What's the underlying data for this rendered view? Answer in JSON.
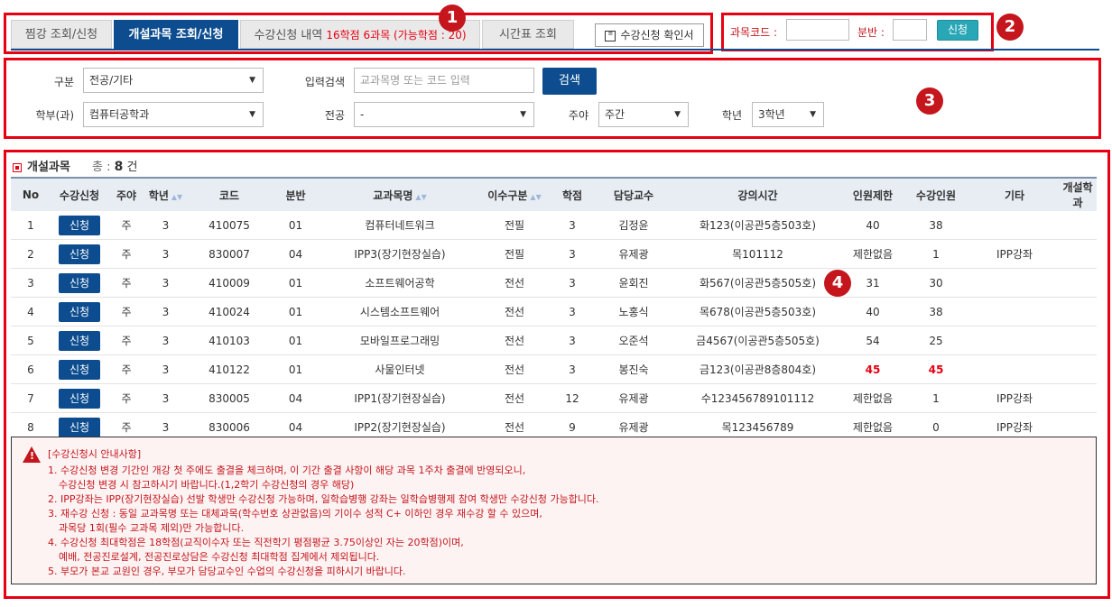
{
  "tabs": [
    {
      "label": "찜강 조회/신청"
    },
    {
      "label": "개설과목 조회/신청"
    },
    {
      "label": "수강신청 내역",
      "highlight": "16학점 6과목 (가능학점 : 20)"
    },
    {
      "label": "시간표 조회"
    }
  ],
  "confirm_button": "수강신청 확인서",
  "apply_form": {
    "course_code_label": "과목코드 :",
    "section_label": "분반 :",
    "submit": "신청",
    "course_code_value": "",
    "section_value": ""
  },
  "search": {
    "category_label": "구분",
    "category_value": "전공/기타",
    "keyword_label": "입력검색",
    "keyword_placeholder": "교과목명 또는 코드 입력",
    "search_button": "검색",
    "dept_label": "학부(과)",
    "dept_value": "컴퓨터공학과",
    "major_label": "전공",
    "major_value": "-",
    "daynight_label": "주야",
    "daynight_value": "주간",
    "year_label": "학년",
    "year_value": "3학년"
  },
  "list": {
    "title": "개설과목",
    "total_label": "총 :",
    "total_count": "8",
    "unit": "건"
  },
  "columns": [
    "No",
    "수강신청",
    "주야",
    "학년",
    "코드",
    "분반",
    "교과목명",
    "이수구분",
    "학점",
    "담당교수",
    "강의시간",
    "인원제한",
    "수강인원",
    "기타",
    "개설학과"
  ],
  "rows": [
    {
      "no": "1",
      "apply": "신청",
      "dn": "주",
      "year": "3",
      "code": "410075",
      "sec": "01",
      "name": "컴퓨터네트워크",
      "type": "전필",
      "credit": "3",
      "prof": "김정윤",
      "time": "화123(이공관5층503호)",
      "limit": "40",
      "enrolled": "38",
      "etc": "",
      "dept": ""
    },
    {
      "no": "2",
      "apply": "신청",
      "dn": "주",
      "year": "3",
      "code": "830007",
      "sec": "04",
      "name": "IPP3(장기현장실습)",
      "type": "전필",
      "credit": "3",
      "prof": "유제광",
      "time": "목101112",
      "limit": "제한없음",
      "enrolled": "1",
      "etc": "IPP강좌",
      "dept": ""
    },
    {
      "no": "3",
      "apply": "신청",
      "dn": "주",
      "year": "3",
      "code": "410009",
      "sec": "01",
      "name": "소프트웨어공학",
      "type": "전선",
      "credit": "3",
      "prof": "윤회진",
      "time": "화567(이공관5층505호)",
      "limit": "31",
      "enrolled": "30",
      "etc": "",
      "dept": ""
    },
    {
      "no": "4",
      "apply": "신청",
      "dn": "주",
      "year": "3",
      "code": "410024",
      "sec": "01",
      "name": "시스템소프트웨어",
      "type": "전선",
      "credit": "3",
      "prof": "노홍식",
      "time": "목678(이공관5층503호)",
      "limit": "40",
      "enrolled": "38",
      "etc": "",
      "dept": ""
    },
    {
      "no": "5",
      "apply": "신청",
      "dn": "주",
      "year": "3",
      "code": "410103",
      "sec": "01",
      "name": "모바일프로그래밍",
      "type": "전선",
      "credit": "3",
      "prof": "오준석",
      "time": "금4567(이공관5층505호)",
      "limit": "54",
      "enrolled": "25",
      "etc": "",
      "dept": ""
    },
    {
      "no": "6",
      "apply": "신청",
      "dn": "주",
      "year": "3",
      "code": "410122",
      "sec": "01",
      "name": "사물인터넷",
      "type": "전선",
      "credit": "3",
      "prof": "봉진숙",
      "time": "금123(이공관8층804호)",
      "limit": "45",
      "enrolled": "45",
      "etc": "",
      "dept": "",
      "full": true
    },
    {
      "no": "7",
      "apply": "신청",
      "dn": "주",
      "year": "3",
      "code": "830005",
      "sec": "04",
      "name": "IPP1(장기현장실습)",
      "type": "전선",
      "credit": "12",
      "prof": "유제광",
      "time": "수123456789101112",
      "limit": "제한없음",
      "enrolled": "1",
      "etc": "IPP강좌",
      "dept": ""
    },
    {
      "no": "8",
      "apply": "신청",
      "dn": "주",
      "year": "3",
      "code": "830006",
      "sec": "04",
      "name": "IPP2(장기현장실습)",
      "type": "전선",
      "credit": "9",
      "prof": "유제광",
      "time": "목123456789",
      "limit": "제한없음",
      "enrolled": "0",
      "etc": "IPP강좌",
      "dept": ""
    }
  ],
  "notice": {
    "title": "[수강신청시 안내사항]",
    "lines": [
      "1. 수강신청 변경 기간인 개강 첫 주에도 출결을 체크하며, 이 기간 출결 사항이 해당 과목 1주차 출결에 반영되오니,",
      "수강신청 변경 시 참고하시기 바랍니다.(1,2학기 수강신청의 경우 해당)",
      "2. IPP강좌는 IPP(장기현장실습) 선발 학생만 수강신청 가능하며, 일학습병행 강좌는 일학습병행제 참여 학생만 수강신청 가능합니다.",
      "3. 재수강 신청 : 동일 교과목명 또는 대체과목(학수번호 상관없음)의 기이수 성적 C+ 이하인 경우 재수강 할 수 있으며,",
      "과목당 1회(필수 교과목 제외)만 가능합니다.",
      "4. 수강신청 최대학점은 18학점(교직이수자 또는 직전학기 평점평균 3.75이상인 자는 20학점)이며,",
      "예배, 전공진로설계, 전공진로상담은 수강신청 최대학점 집계에서 제외됩니다.",
      "5. 부모가 본교 교원인 경우, 부모가 담당교수인 수업의 수강신청을 피하시기 바랍니다."
    ]
  },
  "markers": [
    "1",
    "2",
    "3",
    "4"
  ],
  "colors": {
    "accent": "#0d4d8f",
    "annotation": "#e60012",
    "teal": "#2aa7b7"
  }
}
